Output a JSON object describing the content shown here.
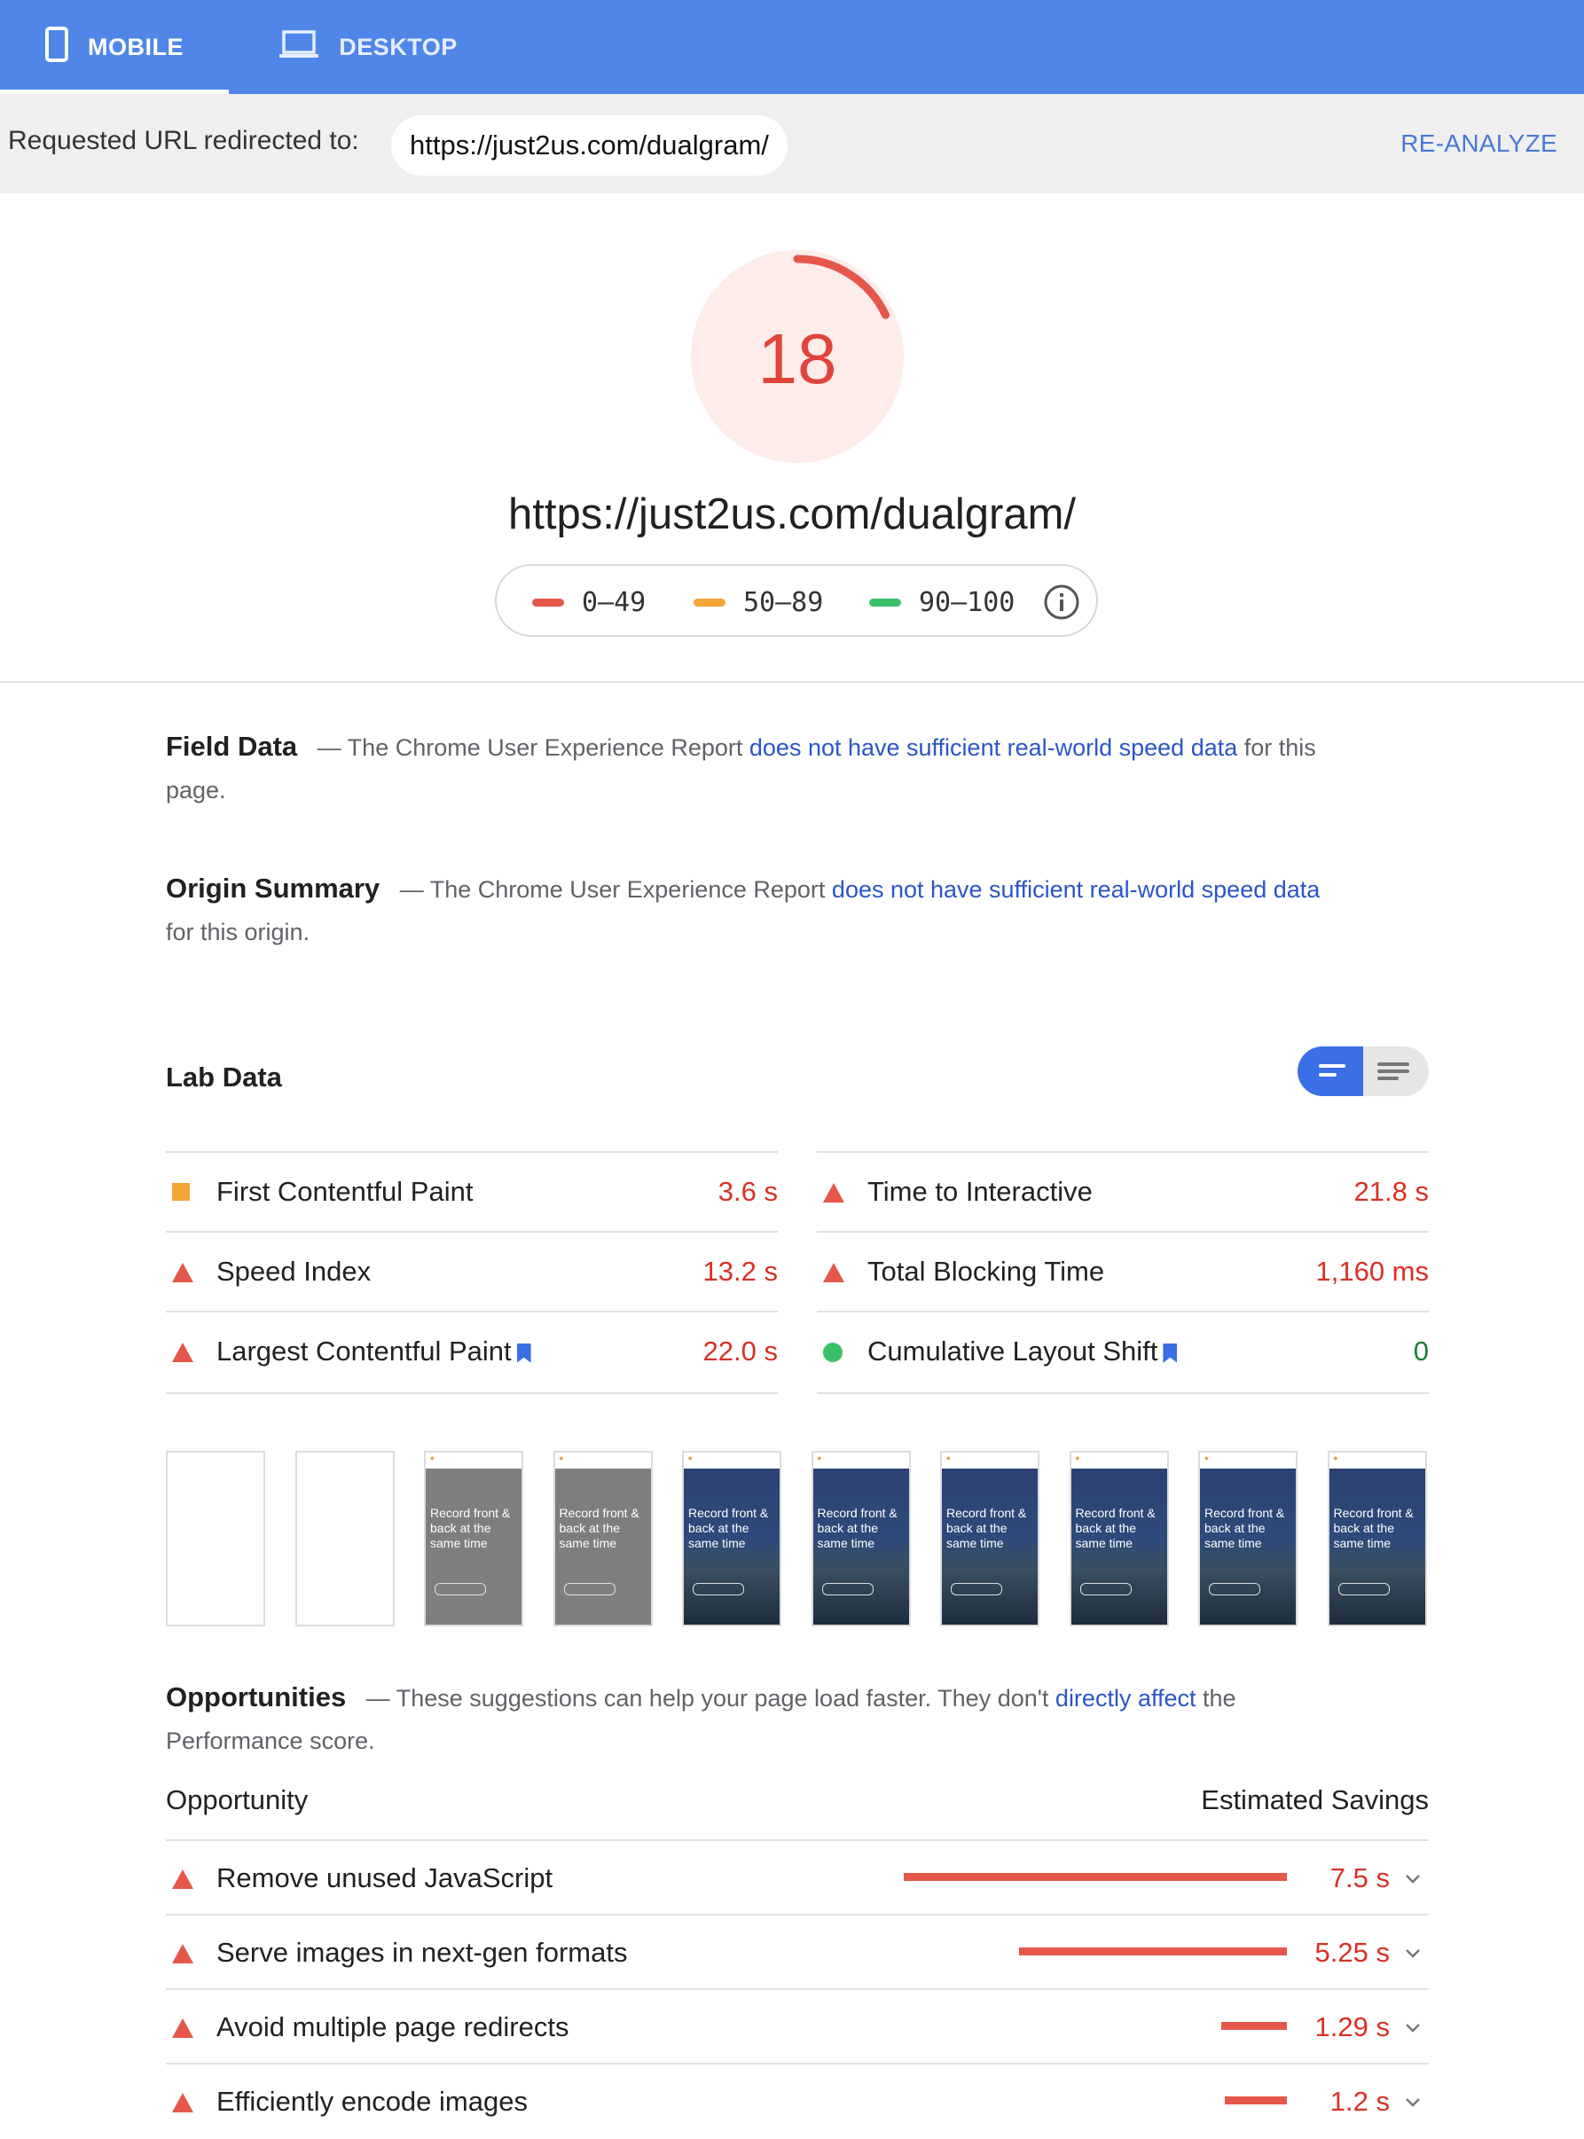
{
  "tabs": [
    {
      "label": "MOBILE",
      "icon": "phone-icon",
      "active": true
    },
    {
      "label": "DESKTOP",
      "icon": "laptop-icon",
      "active": false
    }
  ],
  "redirect": {
    "label": "Requested URL redirected to:",
    "url": "https://just2us.com/dualgram/",
    "reanalyze": "RE-ANALYZE"
  },
  "score": {
    "value": "18",
    "value_fraction": 0.18,
    "url": "https://just2us.com/dualgram/",
    "legend": [
      {
        "label": "0–49",
        "color": "#e5574b"
      },
      {
        "label": "50–89",
        "color": "#f4a534"
      },
      {
        "label": "90–100",
        "color": "#3ac06b"
      }
    ]
  },
  "field_data": {
    "title": "Field Data",
    "prefix": "— The Chrome User Experience Report",
    "link": "does not have sufficient real-world speed data",
    "suffix": "for this page."
  },
  "origin_summary": {
    "title": "Origin Summary",
    "prefix": "— The Chrome User Experience Report",
    "link": "does not have sufficient real-world speed data",
    "suffix": "for this origin."
  },
  "lab": {
    "title": "Lab Data",
    "metrics_left": [
      {
        "label": "First Contentful Paint",
        "value": "3.6 s",
        "status": "average",
        "bookmark": false
      },
      {
        "label": "Speed Index",
        "value": "13.2 s",
        "status": "fail",
        "bookmark": false
      },
      {
        "label": "Largest Contentful Paint",
        "value": "22.0 s",
        "status": "fail",
        "bookmark": true
      }
    ],
    "metrics_right": [
      {
        "label": "Time to Interactive",
        "value": "21.8 s",
        "status": "fail",
        "bookmark": false
      },
      {
        "label": "Total Blocking Time",
        "value": "1,160 ms",
        "status": "fail",
        "bookmark": false
      },
      {
        "label": "Cumulative Layout Shift",
        "value": "0",
        "status": "pass",
        "bookmark": true
      }
    ]
  },
  "filmstrip": {
    "frames": [
      {
        "state": "blank"
      },
      {
        "state": "blank"
      },
      {
        "state": "gray",
        "text": "Record front & back at the same time"
      },
      {
        "state": "gray",
        "text": "Record front & back at the same time"
      },
      {
        "state": "photo",
        "text": "Record front & back at the same time"
      },
      {
        "state": "photo",
        "text": "Record front & back at the same time"
      },
      {
        "state": "photo",
        "text": "Record front & back at the same time"
      },
      {
        "state": "photo",
        "text": "Record front & back at the same time"
      },
      {
        "state": "photo",
        "text": "Record front & back at the same time"
      },
      {
        "state": "photo",
        "text": "Record front & back at the same time"
      }
    ]
  },
  "opportunities": {
    "title": "Opportunities",
    "prefix": "— These suggestions can help your page load faster. They don't",
    "link": "directly affect",
    "suffix": "the Performance score.",
    "col_opportunity": "Opportunity",
    "col_savings": "Estimated Savings",
    "items": [
      {
        "label": "Remove unused JavaScript",
        "savings": "7.5 s",
        "seconds": 7.5
      },
      {
        "label": "Serve images in next-gen formats",
        "savings": "5.25 s",
        "seconds": 5.25
      },
      {
        "label": "Avoid multiple page redirects",
        "savings": "1.29 s",
        "seconds": 1.29
      },
      {
        "label": "Efficiently encode images",
        "savings": "1.2 s",
        "seconds": 1.2
      }
    ]
  },
  "colors": {
    "header": "#4f86e8",
    "fail": "#d93025",
    "average": "#f4a534",
    "pass": "#3ac06b",
    "link": "#2a56c6"
  }
}
